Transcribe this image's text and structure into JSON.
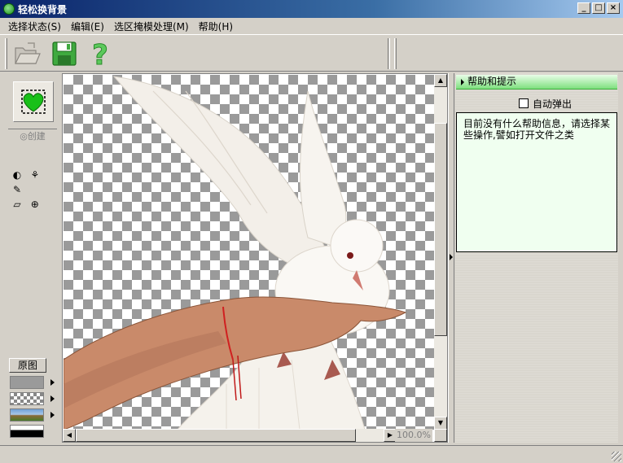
{
  "window": {
    "title": "轻松换背景",
    "minimize": "_",
    "maximize": "□",
    "close": "×"
  },
  "menu": [
    {
      "label": "选择状态(S)"
    },
    {
      "label": "编辑(E)"
    },
    {
      "label": "选区掩模处理(M)"
    },
    {
      "label": "帮助(H)"
    }
  ],
  "toolbar": {
    "icons": [
      "open-folder-icon",
      "save-disk-icon",
      "help-question-icon"
    ]
  },
  "left_panel": {
    "create_label": "◎创建",
    "original_label": "原图",
    "tools": [
      "◐",
      "⚘",
      "✎",
      "▱",
      "⊕"
    ]
  },
  "canvas": {
    "zoom": "100.0%"
  },
  "right_panel": {
    "header": "帮助和提示",
    "autopop_label": "自动弹出",
    "help_text": "目前没有什么帮助信息，请选择某些操作,譬如打开文件之类"
  },
  "colors": {
    "accent_green": "#3cae3c",
    "title_blue": "#0a246a"
  }
}
